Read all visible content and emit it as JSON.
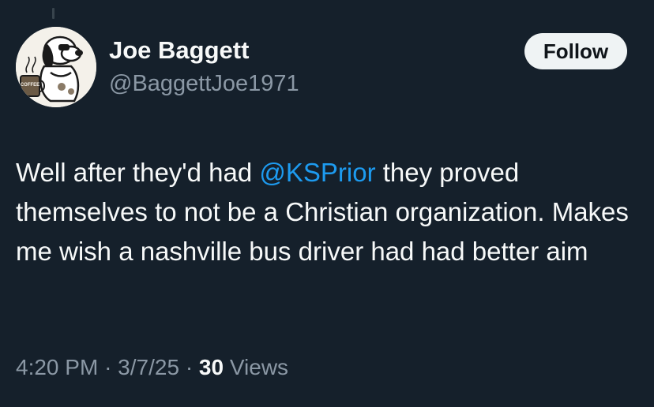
{
  "author": {
    "display_name": "Joe Baggett",
    "handle": "@BaggettJoe1971",
    "avatar": "snoopy-with-coffee-mug-avatar",
    "avatar_mug_text": "COFFEE"
  },
  "follow_button": {
    "label": "Follow"
  },
  "tweet": {
    "text_before": "Well after they'd had ",
    "mention": "@KSPrior",
    "text_after": " they proved themselves to not be a Christian organization. Makes me wish a nashville bus driver had had better aim"
  },
  "meta": {
    "time": "4:20 PM",
    "separator": "·",
    "date": "3/7/25",
    "views_count": "30",
    "views_label": "Views"
  },
  "colors": {
    "background": "#15202b",
    "text_primary": "#f7f9f9",
    "text_secondary": "#8b98a5",
    "link": "#1d9bf0",
    "button_bg": "#eff3f4",
    "button_text": "#0f1419"
  }
}
